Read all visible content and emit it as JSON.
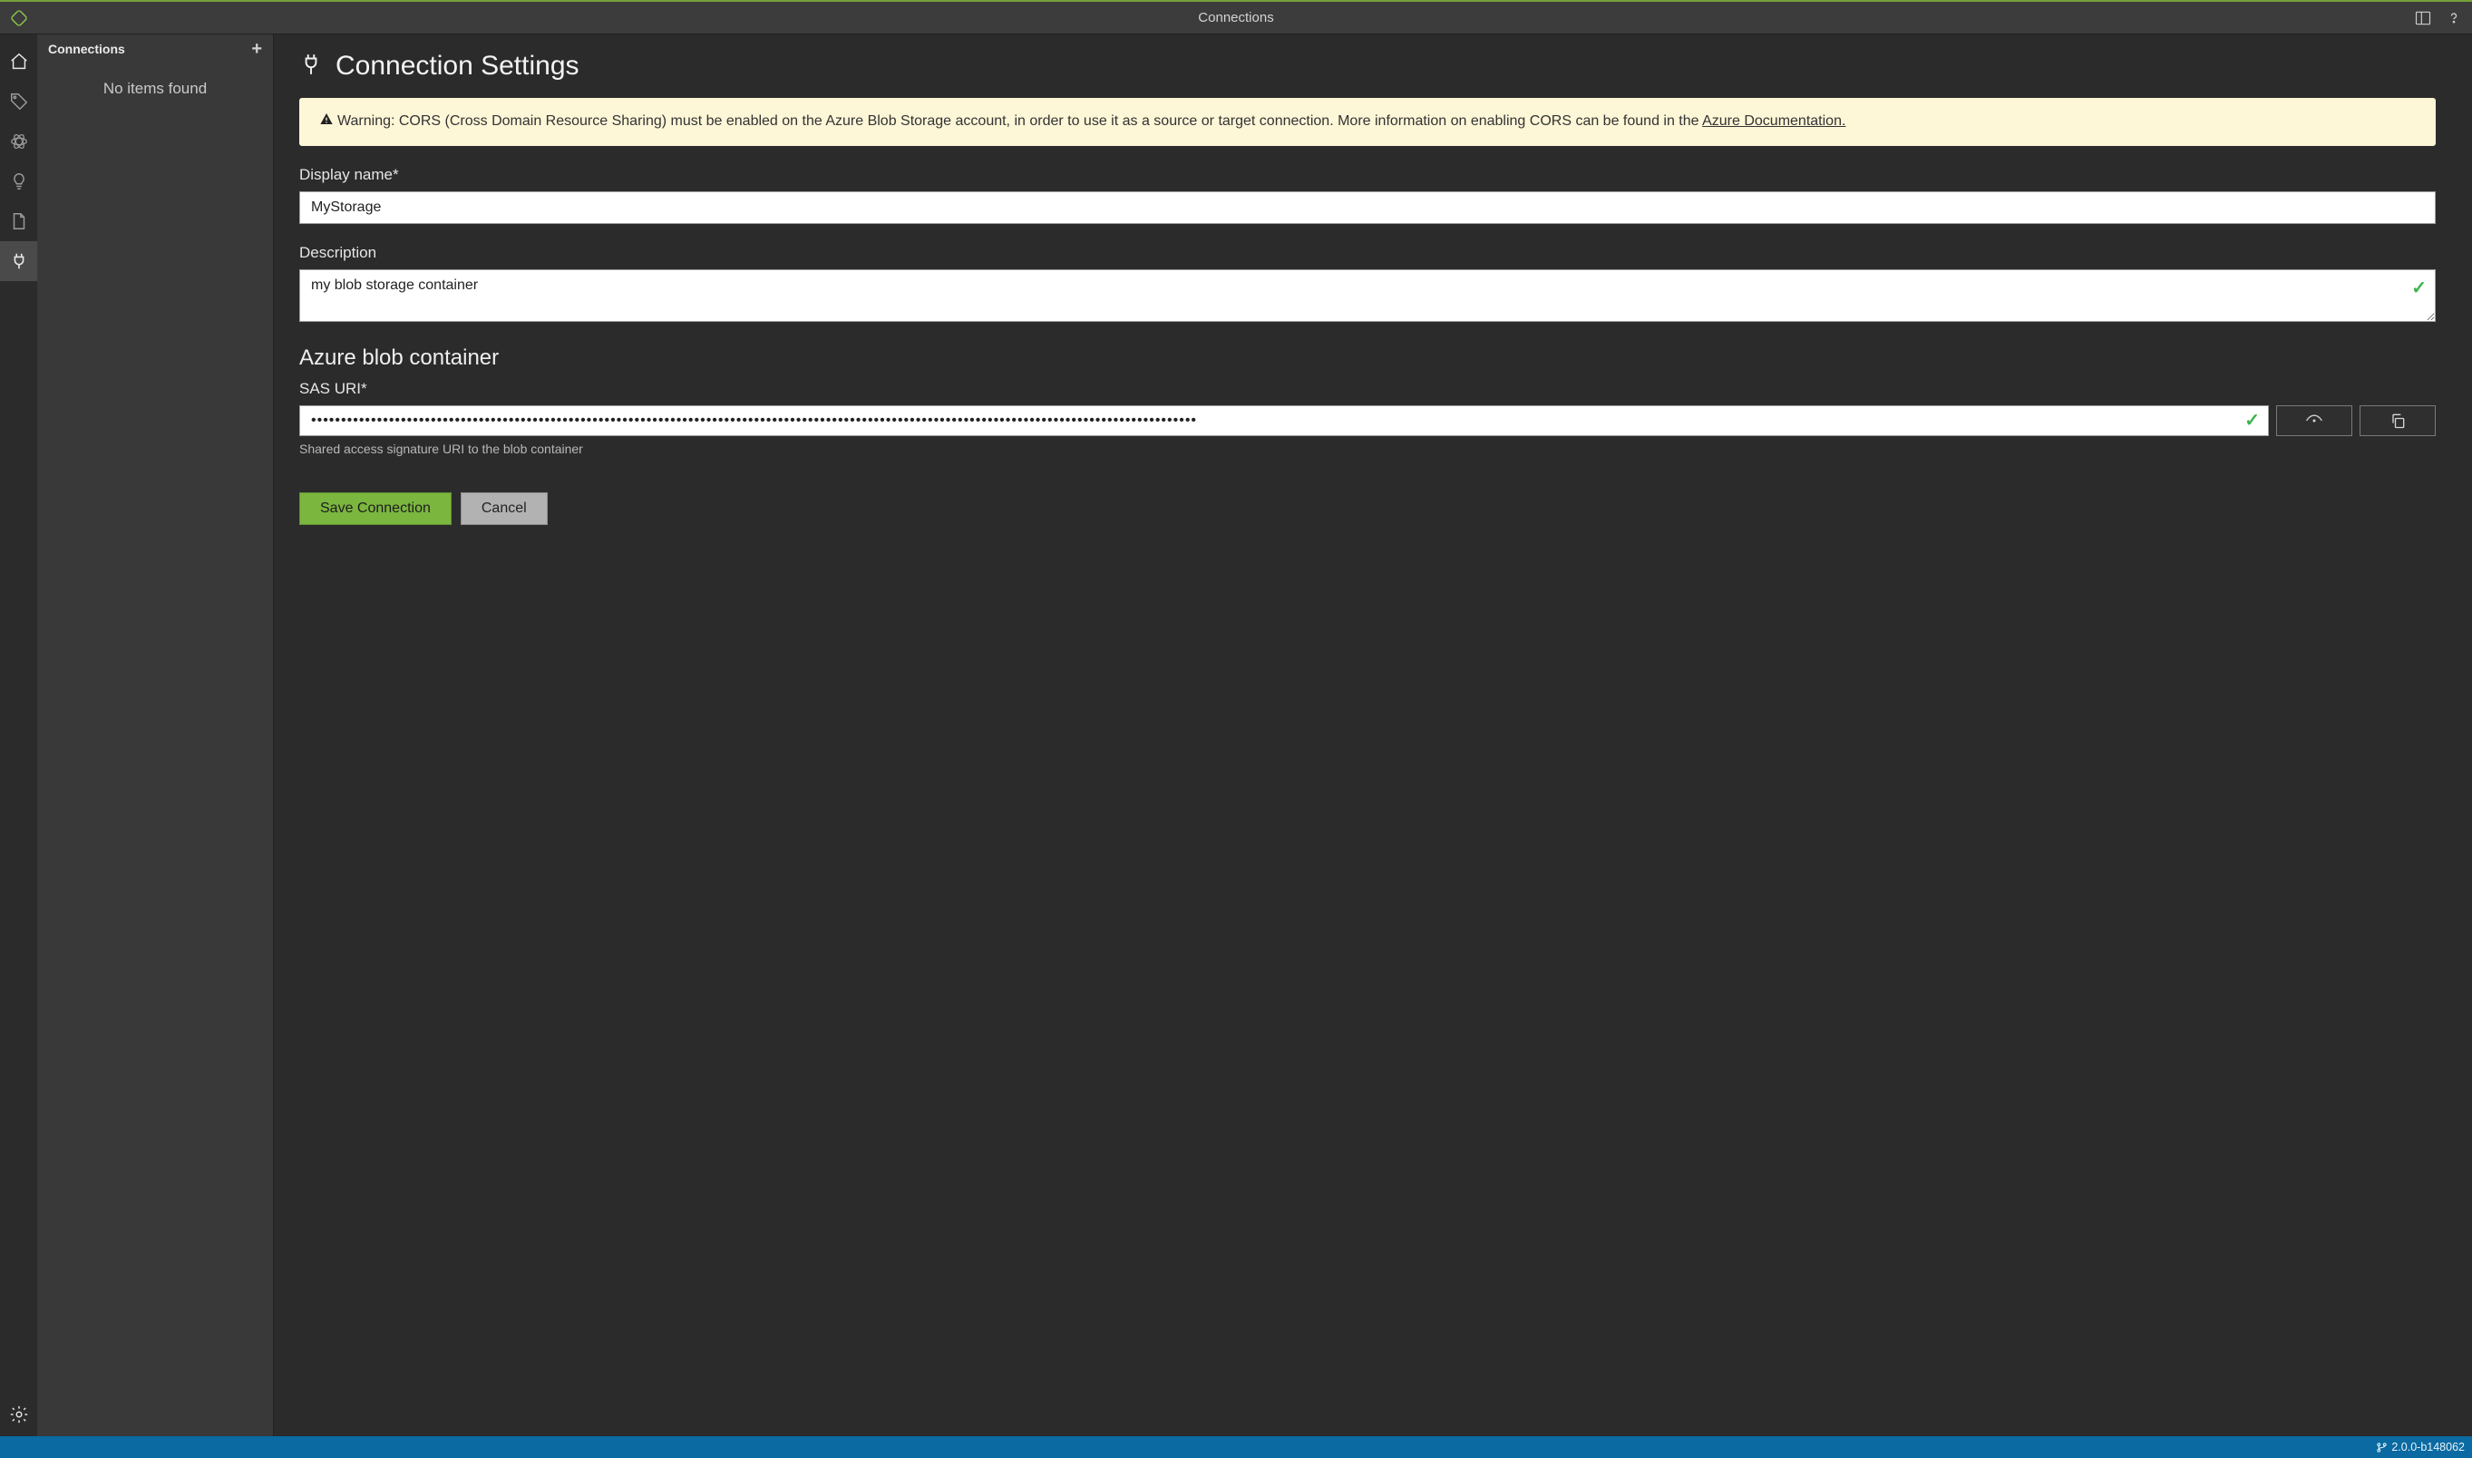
{
  "titlebar": {
    "title": "Connections"
  },
  "sidepanel": {
    "title": "Connections",
    "empty_text": "No items found"
  },
  "page": {
    "heading": "Connection Settings",
    "alert_prefix": "Warning: CORS (Cross Domain Resource Sharing) must be enabled on the Azure Blob Storage account, in order to use it as a source or target connection. More information on enabling CORS can be found in the ",
    "alert_link": "Azure Documentation.",
    "display_name_label": "Display name*",
    "display_name_value": "MyStorage",
    "description_label": "Description",
    "description_value": "my blob storage container",
    "section_heading": "Azure blob container",
    "sas_label": "SAS URI*",
    "sas_masked": "••••••••••••••••••••••••••••••••••••••••••••••••••••••••••••••••••••••••••••••••••••••••••••••••••••••••••••••••••••••••••••••••••••••••••••••••••••",
    "sas_hint": "Shared access signature URI to the blob container",
    "save_label": "Save Connection",
    "cancel_label": "Cancel"
  },
  "statusbar": {
    "version": "2.0.0-b148062"
  },
  "colors": {
    "accent_green": "#7bb63f",
    "alert_bg": "#fdf6d7",
    "status_blue": "#0a6aa1"
  }
}
